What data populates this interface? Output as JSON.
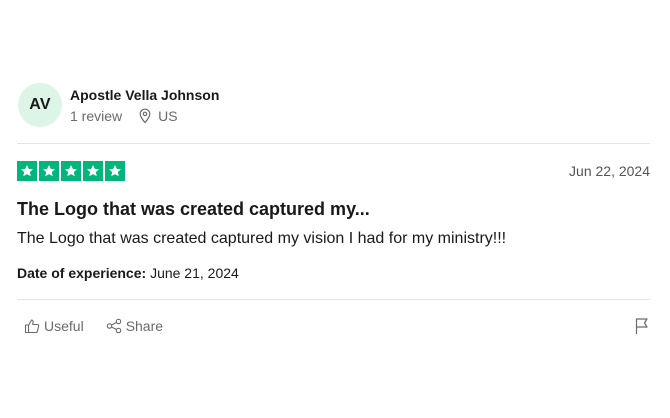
{
  "reviewer": {
    "initials": "AV",
    "name": "Apostle Vella Johnson",
    "review_count": "1 review",
    "country": "US"
  },
  "review": {
    "rating": 5,
    "date": "Jun 22, 2024",
    "title": "The Logo that was created captured my...",
    "body": "The Logo that was created captured my vision I had for my ministry!!!",
    "experience_label": "Date of experience:",
    "experience_date": "June 21, 2024"
  },
  "actions": {
    "useful_label": "Useful",
    "share_label": "Share"
  },
  "colors": {
    "star_green": "#00b67a",
    "avatar_bg": "#dcf5e7"
  },
  "icons": [
    "location-pin-icon",
    "star-icon",
    "thumbs-up-icon",
    "share-icon",
    "flag-icon"
  ]
}
